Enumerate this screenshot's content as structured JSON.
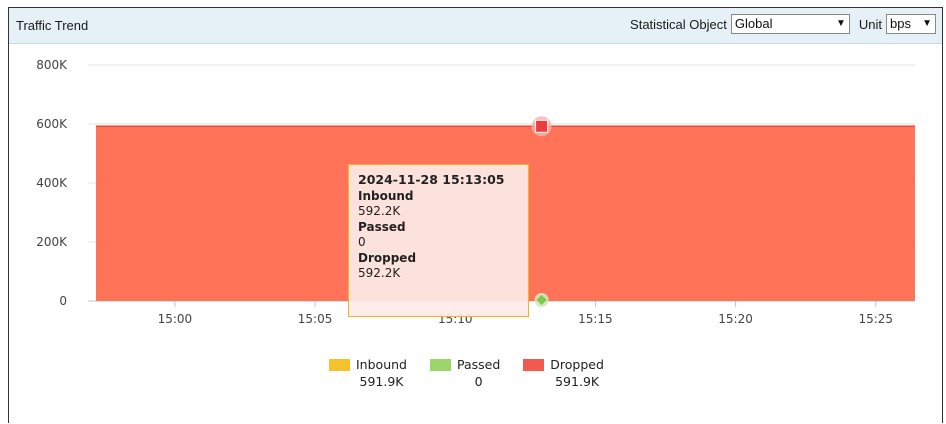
{
  "header": {
    "title": "Traffic Trend",
    "stat_label": "Statistical Object",
    "stat_value": "Global",
    "unit_label": "Unit",
    "unit_value": "bps"
  },
  "tooltip": {
    "time": "2024-11-28 15:13:05",
    "items": [
      {
        "label": "Inbound",
        "value": "592.2K"
      },
      {
        "label": "Passed",
        "value": "0"
      },
      {
        "label": "Dropped",
        "value": "592.2K"
      }
    ]
  },
  "legend": [
    {
      "name": "Inbound",
      "value": "591.9K",
      "color": "#f5c22b"
    },
    {
      "name": "Passed",
      "value": "0",
      "color": "#9bd56c"
    },
    {
      "name": "Dropped",
      "value": "591.9K",
      "color": "#f25a4f"
    }
  ],
  "chart_data": {
    "type": "area",
    "y_ticks": [
      "800K",
      "600K",
      "400K",
      "200K",
      "0"
    ],
    "y_tick_values": [
      800000,
      600000,
      400000,
      200000,
      0
    ],
    "x_ticks": [
      "15:00",
      "15:05",
      "15:10",
      "15:15",
      "15:20",
      "15:25"
    ],
    "x_tick_minutes": [
      0,
      5,
      10,
      15,
      20,
      25
    ],
    "x_range_minutes": [
      -3.1,
      26.4
    ],
    "ylim": [
      0,
      800000
    ],
    "series": [
      {
        "name": "Inbound",
        "color": "#f5c22b",
        "values": [
          592200,
          592200
        ]
      },
      {
        "name": "Passed",
        "color": "#9bd56c",
        "values": [
          0,
          0
        ]
      },
      {
        "name": "Dropped",
        "color": "#ff6b4f",
        "values": [
          592200,
          592200
        ]
      }
    ],
    "highlight": {
      "minute": 13.08,
      "time": "2024-11-28 15:13:05"
    }
  }
}
